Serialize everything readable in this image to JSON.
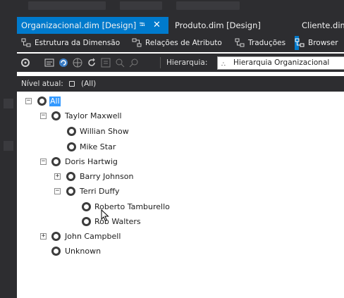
{
  "document_tabs": [
    {
      "label": "Organizacional.dim [Design]",
      "pin_icon": "pin-icon",
      "close_icon": "close-icon",
      "active": true
    },
    {
      "label": "Produto.dim [Design]",
      "active": false
    },
    {
      "label": "Cliente.dim [",
      "active": false
    }
  ],
  "designer_tabs": [
    {
      "label": "Estrutura da Dimensão",
      "icon": "dimension-structure-icon",
      "active": false
    },
    {
      "label": "Relações de Atributo",
      "icon": "attribute-relationships-icon",
      "active": false
    },
    {
      "label": "Traduções",
      "icon": "translations-icon",
      "active": false
    },
    {
      "label": "Browser",
      "icon": "browser-icon",
      "active": true
    }
  ],
  "toolbar": {
    "hierarchy_label": "Hierarquia:",
    "hierarchy_value": "Hierarquia Organizacional",
    "hierarchy_icon": "hierarchy-icon"
  },
  "level": {
    "label": "Nível atual:",
    "value": "(All)"
  },
  "tree": [
    {
      "label": "All",
      "expander": "−",
      "selected": true
    },
    {
      "label": "Taylor Maxwell",
      "expander": "−"
    },
    {
      "label": "Willian Show",
      "expander": ""
    },
    {
      "label": "Mike Star",
      "expander": ""
    },
    {
      "label": "Doris Hartwig",
      "expander": "−"
    },
    {
      "label": "Barry Johnson",
      "expander": "+"
    },
    {
      "label": "Terri Duffy",
      "expander": "−"
    },
    {
      "label": "Roberto Tamburello",
      "expander": ""
    },
    {
      "label": "Rob Walters",
      "expander": ""
    },
    {
      "label": "John Campbell",
      "expander": "+"
    },
    {
      "label": "Unknown",
      "expander": ""
    }
  ],
  "colors": {
    "chrome": "#2d2d30",
    "accent": "#007acc",
    "selection": "#3399ff"
  }
}
